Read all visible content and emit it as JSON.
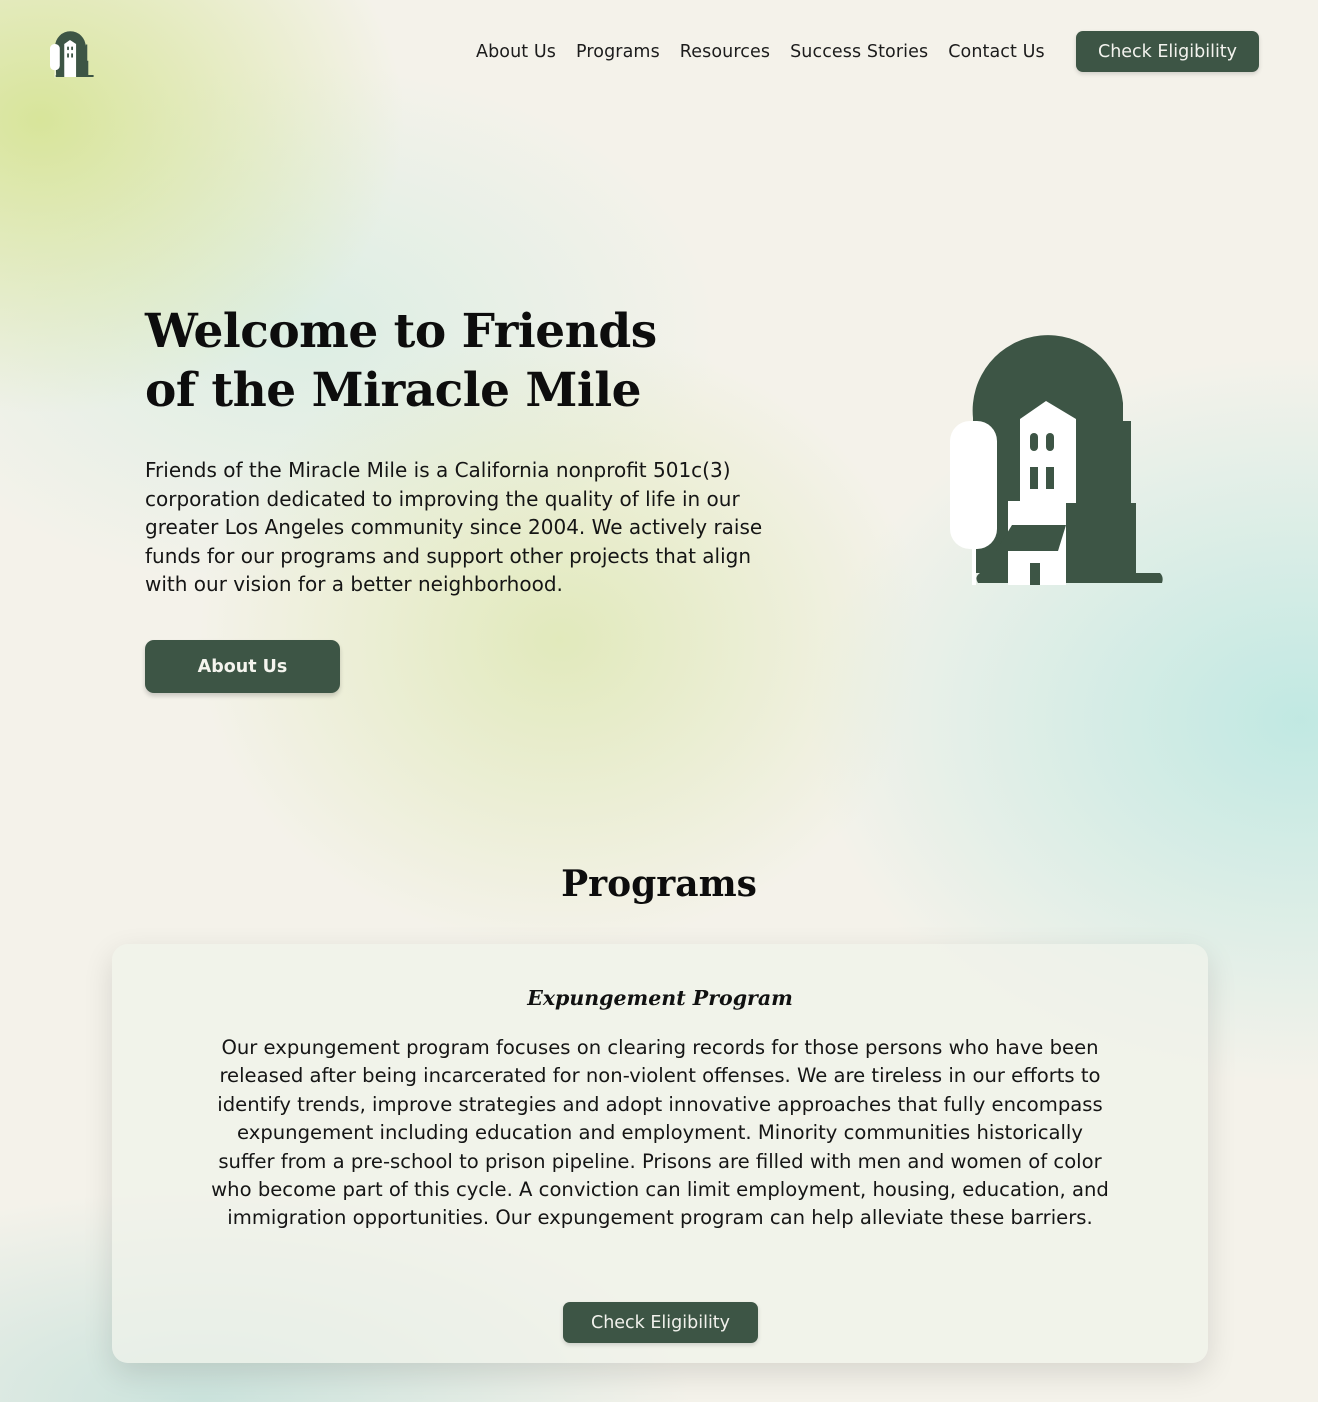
{
  "header": {
    "logo_icon": "building-arch-logo-icon",
    "nav": [
      {
        "label": "About Us"
      },
      {
        "label": "Programs"
      },
      {
        "label": "Resources"
      },
      {
        "label": "Success Stories"
      },
      {
        "label": "Contact Us"
      }
    ],
    "cta_label": "Check Eligibility"
  },
  "hero": {
    "title": "Welcome to Friends of the Miracle Mile",
    "description": "Friends of the Miracle Mile is a California nonprofit 501c(3) corporation dedicated to improving the quality of life in our greater Los Angeles community since 2004.  We actively raise funds for our programs and support other projects that align with our vision for a better neighborhood.",
    "button_label": "About Us",
    "illustration": "building-arch-illustration"
  },
  "programs": {
    "title": "Programs",
    "card": {
      "title": "Expungement Program",
      "text": "Our expungement program focuses on clearing records for those persons who have been released after being incarcerated for non-violent offenses.  We are tireless in our efforts to identify trends, improve strategies and adopt innovative approaches that fully encompass expungement including education and employment. Minority communities historically suffer from a pre-school to prison pipeline. Prisons are filled with men and women of color who become part of this cycle.  A conviction can limit employment, housing, education, and immigration opportunities. Our expungement program can help alleviate these barriers.",
      "button_label": "Check Eligibility"
    }
  },
  "colors": {
    "brand_green": "#3d5545",
    "background": "#f4f2ea"
  }
}
